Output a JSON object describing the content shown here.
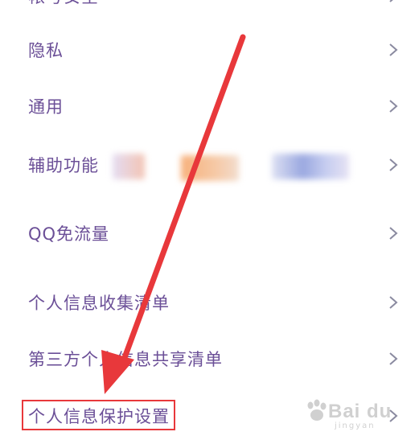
{
  "settings": {
    "partial_item": "帐号安全",
    "items": [
      {
        "label": "隐私"
      },
      {
        "label": "通用"
      },
      {
        "label": "辅助功能"
      },
      {
        "label": "QQ免流量"
      },
      {
        "label": "个人信息收集清单"
      },
      {
        "label": "第三方个人信息共享清单"
      },
      {
        "label": "个人信息保护设置"
      }
    ]
  },
  "colors": {
    "label": "#6b4f97",
    "chevron": "#8a8aa0",
    "highlight": "#e8383b",
    "arrow": "#e8383b"
  },
  "icons": {
    "chevron": "chevron-right-icon",
    "watermark": "baidu-paw-icon"
  },
  "watermark": {
    "text": "Bai du",
    "sub": "jingyan"
  }
}
